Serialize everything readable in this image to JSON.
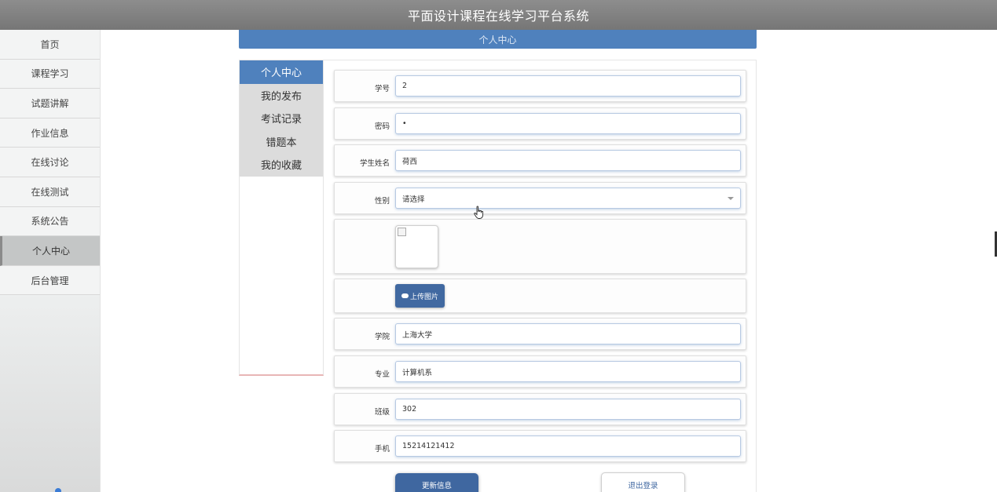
{
  "app": {
    "title": "平面设计课程在线学习平台系统"
  },
  "sidebar": {
    "items": [
      {
        "label": "首页"
      },
      {
        "label": "课程学习"
      },
      {
        "label": "试题讲解"
      },
      {
        "label": "作业信息"
      },
      {
        "label": "在线讨论"
      },
      {
        "label": "在线测试"
      },
      {
        "label": "系统公告"
      },
      {
        "label": "个人中心",
        "active": true
      },
      {
        "label": "后台管理"
      }
    ]
  },
  "header": {
    "title": "个人中心"
  },
  "submenu": {
    "items": [
      {
        "label": "个人中心",
        "active": true
      },
      {
        "label": "我的发布"
      },
      {
        "label": "考试记录"
      },
      {
        "label": "错题本"
      },
      {
        "label": "我的收藏"
      }
    ]
  },
  "form": {
    "student_id": {
      "label": "学号",
      "value": "2"
    },
    "password": {
      "label": "密码",
      "value": "•"
    },
    "name": {
      "label": "学生姓名",
      "value": "荷西"
    },
    "gender": {
      "label": "性别",
      "value": "请选择"
    },
    "upload": {
      "label": "上传图片",
      "icon": "cloud-upload-icon"
    },
    "college": {
      "label": "学院",
      "value": "上海大学"
    },
    "major": {
      "label": "专业",
      "value": "计算机系"
    },
    "class": {
      "label": "班级",
      "value": "302"
    },
    "phone": {
      "label": "手机",
      "value": "15214121412"
    }
  },
  "actions": {
    "update_label": "更新信息",
    "logout_label": "退出登录"
  },
  "colors": {
    "accent": "#4f81bd",
    "button": "#3f67a0",
    "topbar": "#808080"
  }
}
